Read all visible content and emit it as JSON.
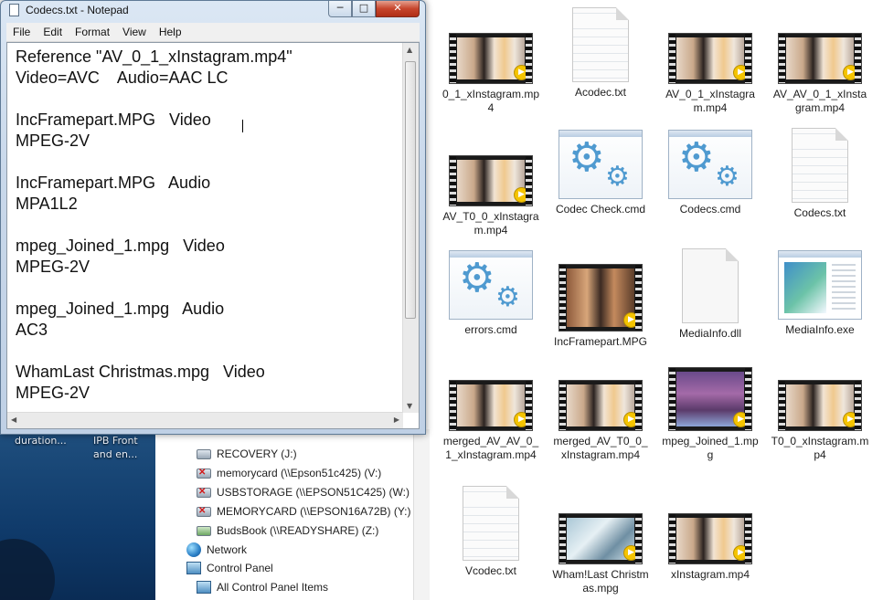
{
  "notepad": {
    "title": "Codecs.txt - Notepad",
    "min_symbol": "─",
    "max_symbol": "□",
    "close_symbol": "✕",
    "menus": [
      "File",
      "Edit",
      "Format",
      "View",
      "Help"
    ],
    "content": "Reference \"AV_0_1_xInstagram.mp4\"\nVideo=AVC    Audio=AAC LC\n\nIncFramepart.MPG   Video\nMPEG-2V\n\nIncFramepart.MPG   Audio\nMPA1L2\n\nmpeg_Joined_1.mpg   Video\nMPEG-2V\n\nmpeg_Joined_1.mpg   Audio\nAC3\n\nWhamLast Christmas.mpg   Video\nMPEG-2V"
  },
  "desktop": {
    "text_a": "duration...",
    "text_b": "IPB Front",
    "text_c": "and en..."
  },
  "nav": {
    "items": [
      {
        "label": "RECOVERY (J:)",
        "type": "drive"
      },
      {
        "label": "memorycard (\\\\Epson51c425) (V:)",
        "type": "net-error"
      },
      {
        "label": "USBSTORAGE (\\\\EPSON51C425) (W:)",
        "type": "net-error"
      },
      {
        "label": "MEMORYCARD (\\\\EPSON16A72B) (Y:)",
        "type": "net-error"
      },
      {
        "label": "BudsBook (\\\\READYSHARE) (Z:)",
        "type": "net-share"
      },
      {
        "label": "Network",
        "type": "network"
      },
      {
        "label": "Control Panel",
        "type": "control"
      },
      {
        "label": "All Control Panel Items",
        "type": "control"
      }
    ]
  },
  "files": [
    {
      "label": "0_1_xInstagram.mp4",
      "type": "video",
      "thumb": "insta"
    },
    {
      "label": "Acodec.txt",
      "type": "txt"
    },
    {
      "label": "AV_0_1_xInstagram.mp4",
      "type": "video",
      "thumb": "insta"
    },
    {
      "label": "AV_AV_0_1_xInstagram.mp4",
      "type": "video",
      "thumb": "insta"
    },
    {
      "label": "AV_T0_0_xInstagram.mp4",
      "type": "video",
      "thumb": "insta"
    },
    {
      "label": "Codec Check.cmd",
      "type": "cmd"
    },
    {
      "label": "Codecs.cmd",
      "type": "cmd"
    },
    {
      "label": "Codecs.txt",
      "type": "txt"
    },
    {
      "label": "errors.cmd",
      "type": "cmd"
    },
    {
      "label": "IncFramepart.MPG",
      "type": "video",
      "thumb": "movie"
    },
    {
      "label": "MediaInfo.dll",
      "type": "dll"
    },
    {
      "label": "MediaInfo.exe",
      "type": "exe"
    },
    {
      "label": "merged_AV_AV_0_1_xInstagram.mp4",
      "type": "video",
      "thumb": "insta"
    },
    {
      "label": "merged_AV_T0_0_xInstagram.mp4",
      "type": "video",
      "thumb": "insta"
    },
    {
      "label": "mpeg_Joined_1.mpg",
      "type": "video",
      "thumb": "ring"
    },
    {
      "label": "T0_0_xInstagram.mp4",
      "type": "video",
      "thumb": "insta"
    },
    {
      "label": "Vcodec.txt",
      "type": "txt"
    },
    {
      "label": "Wham!Last Christmas.mpg",
      "type": "video",
      "thumb": "wham"
    },
    {
      "label": "xInstagram.mp4",
      "type": "video",
      "thumb": "insta"
    }
  ],
  "icons": {
    "play_badge": "▶",
    "gear": "⚙"
  }
}
